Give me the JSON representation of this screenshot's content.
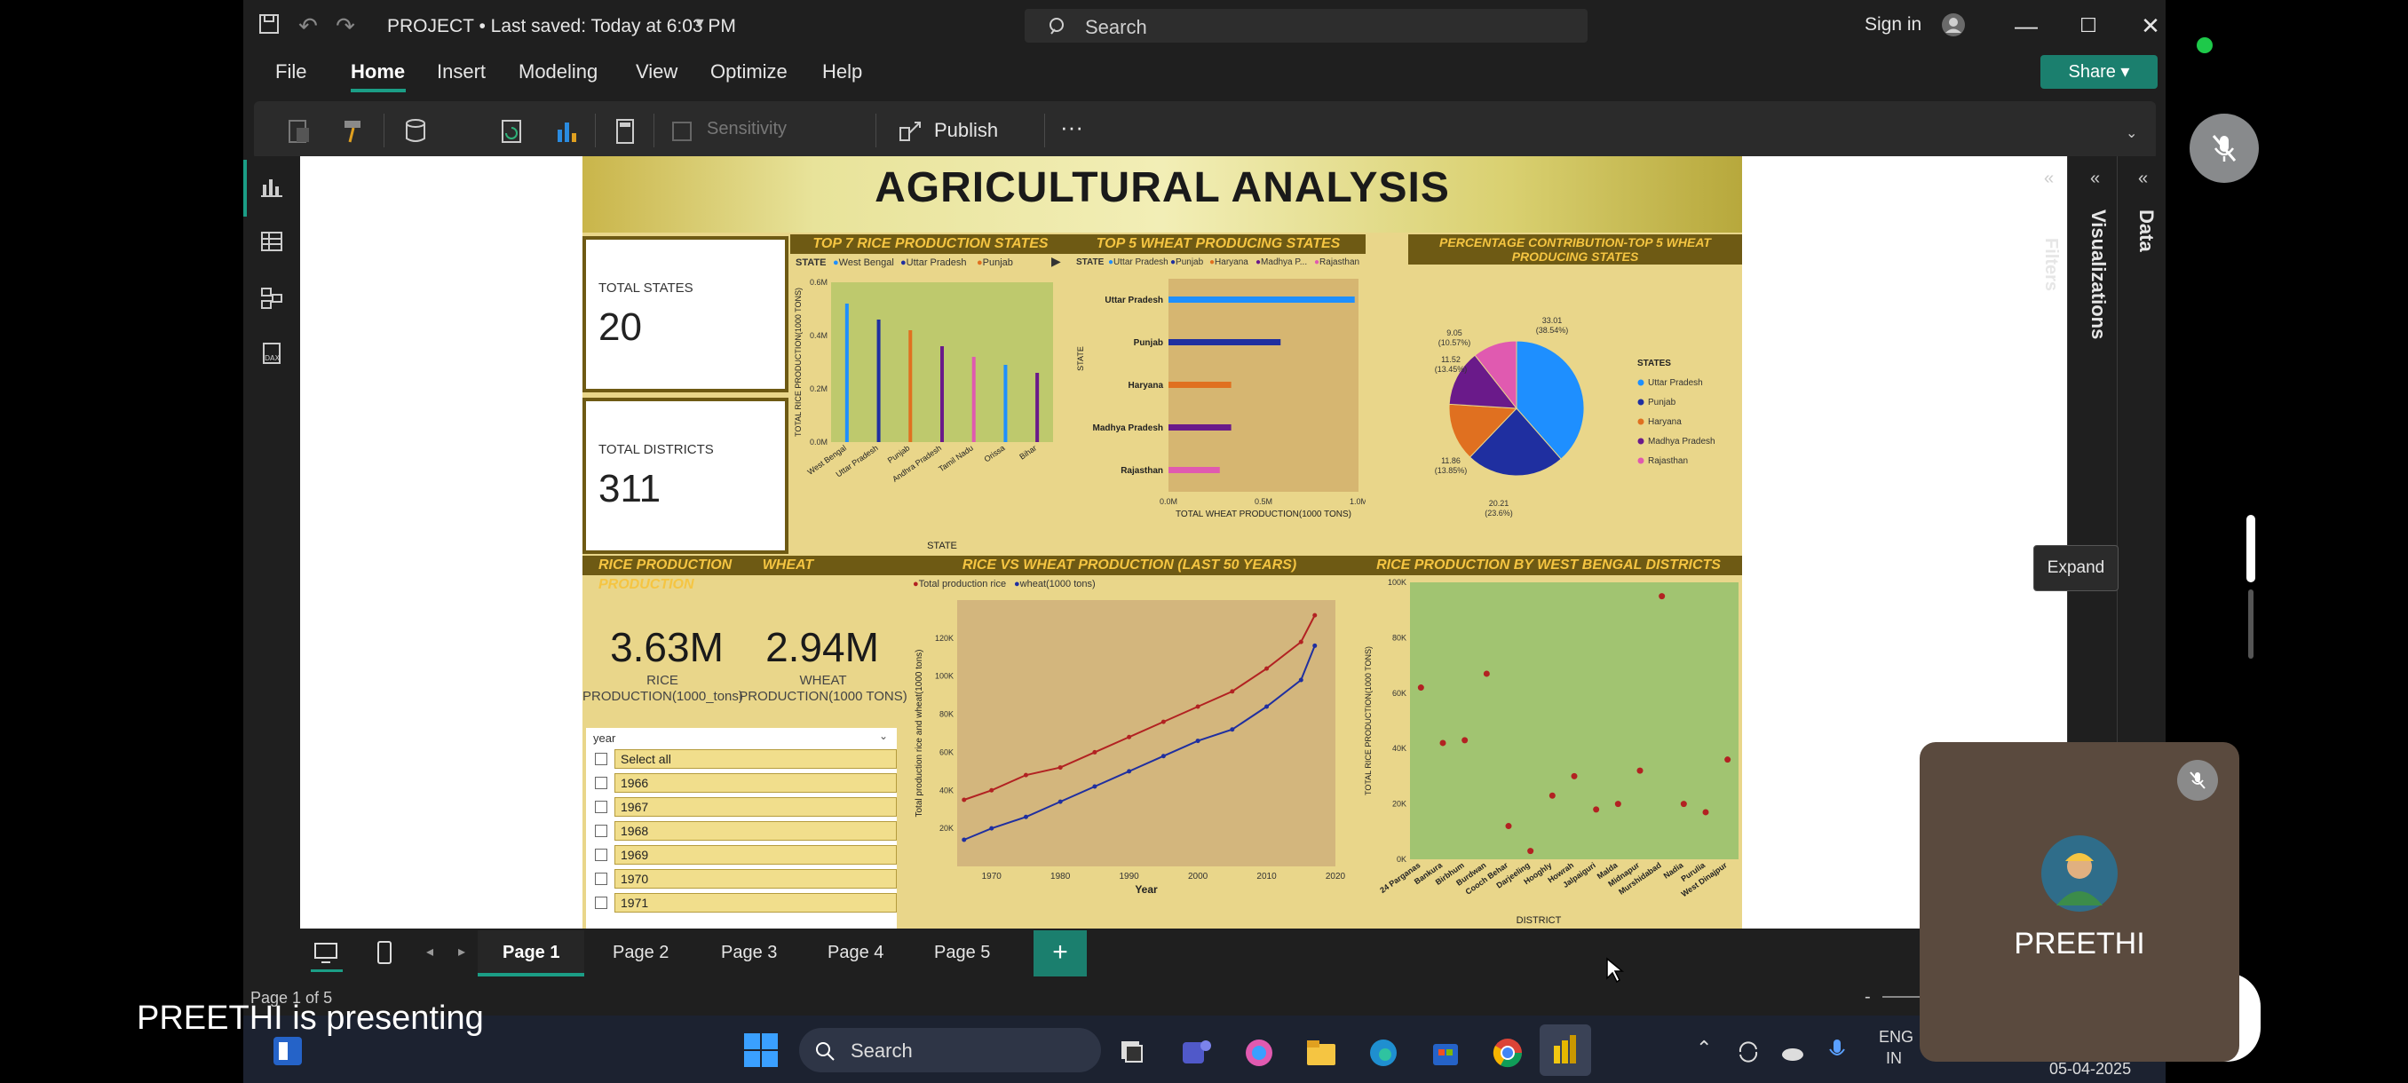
{
  "app": {
    "doc_title": "PROJECT • Last saved: Today at 6:03 PM",
    "search_label": "Search",
    "signin": "Sign in",
    "menu": [
      "File",
      "Home",
      "Insert",
      "Modeling",
      "View",
      "Optimize",
      "Help"
    ],
    "active_menu": "Home",
    "share": "Share",
    "ribbon": {
      "sensitivity": "Sensitivity",
      "publish": "Publish",
      "more": "···"
    },
    "panes": {
      "filters": "Filters",
      "visualizations": "Visualizations",
      "data": "Data"
    },
    "expand_tooltip": "Expand",
    "pages": [
      "Page 1",
      "Page 2",
      "Page 3",
      "Page 4",
      "Page 5"
    ],
    "active_page": "Page 1",
    "status": "Page 1 of 5",
    "accent": "#1b7f6e"
  },
  "report": {
    "title": "AGRICULTURAL ANALYSIS",
    "total_states_label": "TOTAL STATES",
    "total_states_value": "20",
    "total_districts_label": "TOTAL DISTRICTS",
    "total_districts_value": "311",
    "rice_header": "RICE PRODUCTION",
    "wheat_header": "WHEAT PRODUCTION",
    "rice_value": "3.63M",
    "rice_label_1": "RICE",
    "rice_label_2": "PRODUCTION(1000_tons)",
    "wheat_value": "2.94M",
    "wheat_label_1": "WHEAT",
    "wheat_label_2": "PRODUCTION(1000 TONS)",
    "slicer_title": "year",
    "slicer_items": [
      "Select all",
      "1966",
      "1967",
      "1968",
      "1969",
      "1970",
      "1971"
    ]
  },
  "chart_data": [
    {
      "type": "bar",
      "title": "TOP 7 RICE PRODUCTION STATES",
      "legend_title": "STATE",
      "legend": [
        "West Bengal",
        "Uttar Pradesh",
        "Punjab"
      ],
      "categories": [
        "West Bengal",
        "Uttar Pradesh",
        "Punjab",
        "Andhra Pradesh",
        "Tamil Nadu",
        "Orissa",
        "Bihar"
      ],
      "values": [
        0.52,
        0.46,
        0.42,
        0.36,
        0.32,
        0.29,
        0.26
      ],
      "colors": [
        "#1e8fff",
        "#1f2fa0",
        "#e07020",
        "#6a1a8a",
        "#e05ab0",
        "#1e8fff",
        "#6a1a8a"
      ],
      "xlabel": "STATE",
      "ylabel": "TOTAL RICE PRODUCTION(1000 TONS)",
      "yticks": [
        "0.0M",
        "0.2M",
        "0.4M",
        "0.6M"
      ],
      "ylim": [
        0,
        0.6
      ]
    },
    {
      "type": "bar",
      "orientation": "horizontal",
      "title": "TOP 5 WHEAT PRODUCING STATES",
      "legend_title": "STATE",
      "legend": [
        "Uttar Pradesh",
        "Punjab",
        "Haryana",
        "Madhya P...",
        "Rajasthan"
      ],
      "categories": [
        "Uttar Pradesh",
        "Punjab",
        "Haryana",
        "Madhya Pradesh",
        "Rajasthan"
      ],
      "values": [
        0.98,
        0.59,
        0.33,
        0.33,
        0.27
      ],
      "colors": [
        "#1e8fff",
        "#1f2fa0",
        "#e07020",
        "#6a1a8a",
        "#e05ab0"
      ],
      "xlabel": "TOTAL WHEAT PRODUCTION(1000 TONS)",
      "ylabel": "STATE",
      "xticks": [
        "0.0M",
        "0.5M",
        "1.0M"
      ],
      "xlim": [
        0,
        1.0
      ]
    },
    {
      "type": "pie",
      "title": "PERCENTAGE CONTRIBUTION-TOP 5 WHEAT PRODUCING STATES",
      "legend_title": "STATES",
      "categories": [
        "Uttar Pradesh",
        "Punjab",
        "Haryana",
        "Madhya Pradesh",
        "Rajasthan"
      ],
      "values": [
        38.54,
        23.6,
        13.85,
        13.45,
        10.57
      ],
      "slice_labels": [
        "33.01 (38.54%)",
        "20.21 (23.6%)",
        "11.86 (13.85%)",
        "11.52 (13.45%)",
        "9.05 (10.57%)"
      ],
      "colors": [
        "#1e8fff",
        "#1f2fa0",
        "#e07020",
        "#6a1a8a",
        "#e05ab0"
      ]
    },
    {
      "type": "line",
      "title": "RICE VS WHEAT PRODUCTION (LAST 50 YEARS)",
      "series": [
        {
          "name": "Total production rice",
          "color": "#b22222",
          "x": [
            1966,
            1970,
            1975,
            1980,
            1985,
            1990,
            1995,
            2000,
            2005,
            2010,
            2015,
            2017
          ],
          "values": [
            35,
            40,
            48,
            52,
            60,
            68,
            76,
            84,
            92,
            104,
            118,
            132
          ]
        },
        {
          "name": "wheat(1000 tons)",
          "color": "#1f2fa0",
          "x": [
            1966,
            1970,
            1975,
            1980,
            1985,
            1990,
            1995,
            2000,
            2005,
            2010,
            2015,
            2017
          ],
          "values": [
            14,
            20,
            26,
            34,
            42,
            50,
            58,
            66,
            72,
            84,
            98,
            116
          ]
        }
      ],
      "xlabel": "Year",
      "ylabel": "Total production rice and wheat(1000 tons)",
      "xticks": [
        "1970",
        "1980",
        "1990",
        "2000",
        "2010",
        "2020"
      ],
      "yticks": [
        "20K",
        "40K",
        "60K",
        "80K",
        "100K",
        "120K"
      ],
      "xlim": [
        1965,
        2020
      ],
      "ylim": [
        0,
        140
      ]
    },
    {
      "type": "scatter",
      "title": "RICE PRODUCTION BY WEST BENGAL DISTRICTS",
      "categories": [
        "24 Parganas",
        "Bankura",
        "Birbhum",
        "Burdwan",
        "Cooch Behar",
        "Darjeeling",
        "Hooghly",
        "Howrah",
        "Jalpaiguri",
        "Malda",
        "Midnapur",
        "Murshidabad",
        "Nadia",
        "Purulia",
        "West Dinajpur"
      ],
      "values": [
        62,
        42,
        43,
        67,
        12,
        3,
        23,
        30,
        18,
        20,
        32,
        95,
        20,
        17,
        36
      ],
      "color": "#b22222",
      "xlabel": "DISTRICT",
      "ylabel": "TOTAL RICE PRODUCTION(1000 TONS)",
      "yticks": [
        "0K",
        "20K",
        "40K",
        "60K",
        "80K",
        "100K"
      ],
      "ylim": [
        0,
        100
      ]
    }
  ],
  "taskbar": {
    "search": "Search",
    "lang1": "ENG",
    "lang2": "IN",
    "date": "05-04-2025"
  },
  "presenter": {
    "name": "PREETHI",
    "presenting": "PREETHI is presenting"
  }
}
